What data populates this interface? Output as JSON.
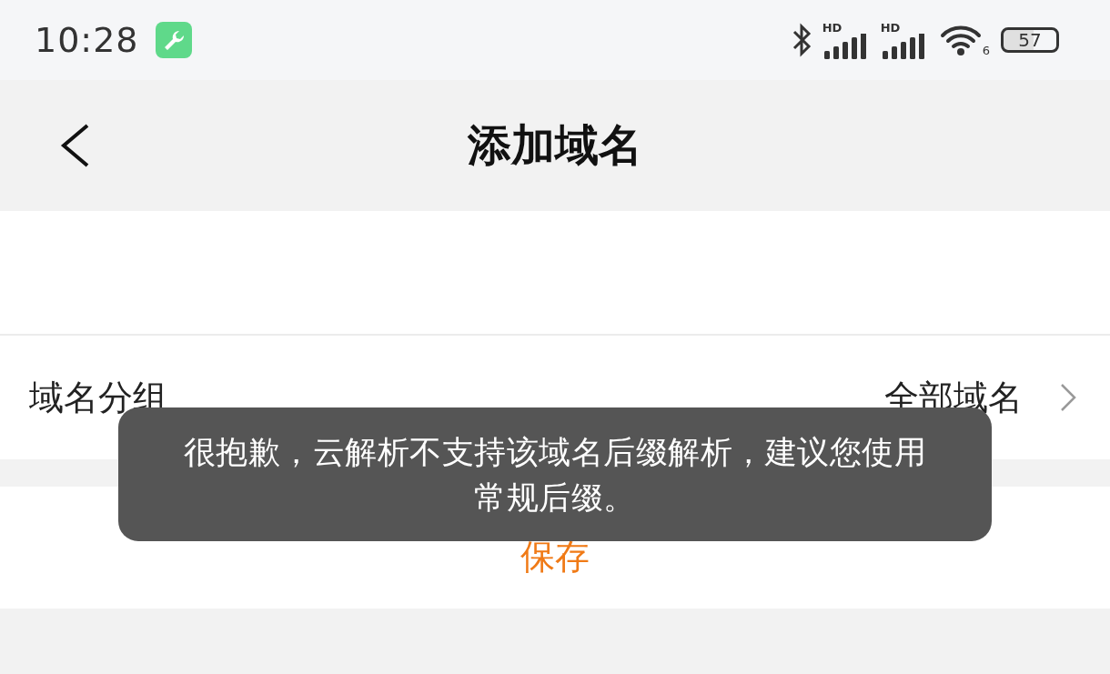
{
  "status_bar": {
    "time": "10:28",
    "signals": [
      {
        "label": "HD"
      },
      {
        "label": "HD"
      }
    ],
    "wifi_label": "6",
    "battery": "57"
  },
  "header": {
    "title": "添加域名"
  },
  "group_row": {
    "label": "域名分组",
    "value": "全部域名"
  },
  "save_button": {
    "label": "保存"
  },
  "toast": {
    "text": "很抱歉，云解析不支持该域名后缀解析，建议您使用常规后缀。"
  }
}
